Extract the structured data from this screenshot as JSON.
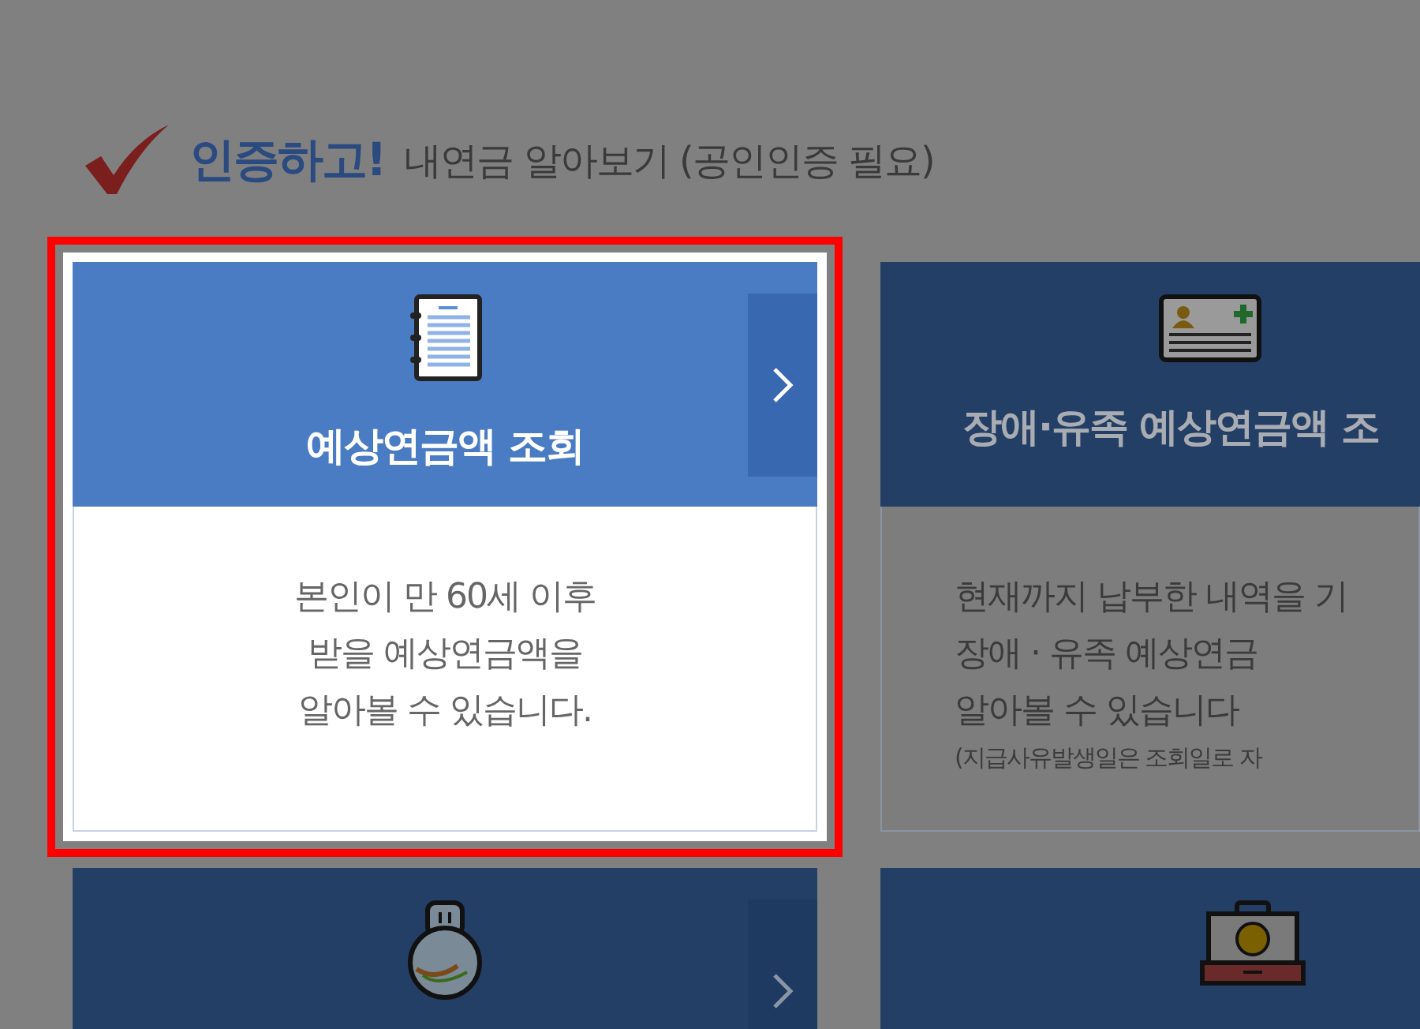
{
  "heading": {
    "emphasis": "인증하고!",
    "text": "내연금 알아보기 (공인인증 필요)"
  },
  "cards": [
    {
      "kind": "notebook",
      "highlighted": true,
      "has_arrow": true,
      "title": "예상연금액 조회",
      "description": [
        "본인이 만 60세 이후",
        "받을 예상연금액을",
        "알아볼 수 있습니다."
      ]
    },
    {
      "kind": "id-card",
      "highlighted": false,
      "has_arrow": false,
      "title": "장애·유족 예상연금액 조",
      "description": [
        "현재까지 납부한 내역을 기",
        "장애  ·  유족 예상연금",
        "알아볼 수 있습니다"
      ],
      "note": "(지급사유발생일은 조회일로 자"
    },
    {
      "kind": "nps-bag",
      "highlighted": false,
      "has_arrow": true
    },
    {
      "kind": "briefcase",
      "highlighted": false,
      "has_arrow": false
    }
  ]
}
